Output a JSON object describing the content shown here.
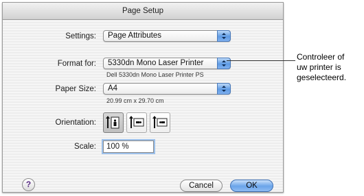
{
  "dialog": {
    "title": "Page Setup",
    "settings": {
      "label": "Settings:",
      "value": "Page Attributes"
    },
    "format_for": {
      "label": "Format for:",
      "value": "5330dn Mono Laser Printer",
      "sub_text": "Dell 5330dn Mono Laser Printer PS"
    },
    "paper_size": {
      "label": "Paper Size:",
      "value": "A4",
      "sub_text": "20.99 cm x 29.70 cm"
    },
    "orientation": {
      "label": "Orientation:",
      "options": [
        "portrait",
        "landscape-left",
        "landscape-right"
      ],
      "selected": "portrait"
    },
    "scale": {
      "label": "Scale:",
      "value": "100 %"
    },
    "help_label": "?",
    "cancel_label": "Cancel",
    "ok_label": "OK"
  },
  "callout": {
    "line1": "Controleer of",
    "line2": "uw printer is",
    "line3": "geselecteerd."
  },
  "colors": {
    "accent_blue": "#5f9be4",
    "focus_ring": "#9cc0ea",
    "dialog_bg": "#ededed"
  }
}
